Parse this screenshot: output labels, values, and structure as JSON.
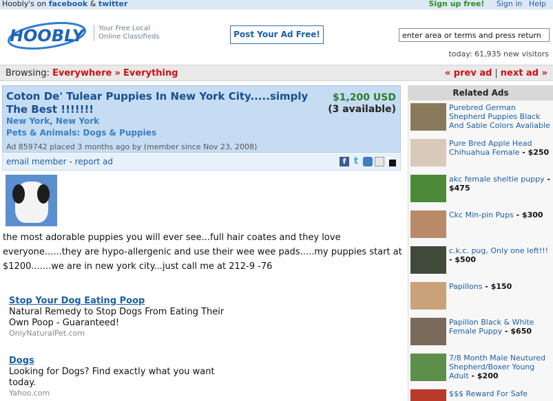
{
  "topbar": {
    "social_text": "Hoobly's on",
    "facebook": "facebook",
    "and": "&",
    "twitter": "twitter",
    "signup": "Sign up free!",
    "signin": "Sign in",
    "help": "Help"
  },
  "header": {
    "logo_text": "HOOBLY",
    "tagline_line1": "Your Free Local",
    "tagline_line2": "Online Classifieds",
    "post_ad": "Post Your Ad Free!",
    "search_value": "enter area or terms and press return",
    "visitors": "today: 61,935 new visitors"
  },
  "browse": {
    "label": "Browsing:",
    "everywhere": "Everywhere",
    "sep": "»",
    "everything": "Everything",
    "prev": "« prev ad",
    "divider": "|",
    "next": "next ad »"
  },
  "ad": {
    "title": "Coton De' Tulear Puppies In New York City.....simply The Best !!!!!!!",
    "price": "$1,200 USD",
    "availability": "(3 available)",
    "location": "New York, New York",
    "category": "Pets & Animals: Dogs & Puppies",
    "meta": "Ad 859742 placed 3 months ago by (member since Nov 23, 2008)",
    "email": "email member",
    "dash": "-",
    "report": "report ad",
    "description": "the most adorable puppies you will ever see...full hair coates and they love everyone......they are hypo-allergenic and use their wee wee pads.....my puppies start at $1200.......we are in new york city...just call me at 212-9  -76"
  },
  "sponsored": [
    {
      "title": "Stop Your Dog Eating Poop",
      "desc": "Natural Remedy to Stop Dogs From Eating Their Own Poop - Guaranteed!",
      "url": "OnlyNaturalPet.com"
    },
    {
      "title": "Dogs",
      "desc": "Looking for Dogs? Find exactly what you want today.",
      "url": "Yahoo.com"
    }
  ],
  "related": {
    "header": "Related Ads",
    "items": [
      {
        "title": "Purebred German Shepherd Puppies Black And Sable Colors Avaliable",
        "price": ""
      },
      {
        "title": "Pure Bred Apple Head Chihuahua Female",
        "price": "- $250"
      },
      {
        "title": "akc female sheltie puppy",
        "price": "- $475"
      },
      {
        "title": "Ckc Min-pin Pups",
        "price": "- $300"
      },
      {
        "title": "c.k.c. pug, Only one left!!!",
        "price": "- $500"
      },
      {
        "title": "Papillons",
        "price": "- $150"
      },
      {
        "title": "Papillon Black & White Female Puppy",
        "price": "- $650"
      },
      {
        "title": "7/8 Month Male Neutured Shepherd/Boxer Young Adult",
        "price": "- $200"
      },
      {
        "title": "$$$ Reward For Safe",
        "price": ""
      }
    ],
    "thumb_colors": [
      "#8a7a5c",
      "#d9c9b8",
      "#4c8a3a",
      "#b88a6a",
      "#3f4a3a",
      "#c9a27a",
      "#7a6a5a",
      "#5c8f4a",
      "#b83a2a"
    ]
  }
}
